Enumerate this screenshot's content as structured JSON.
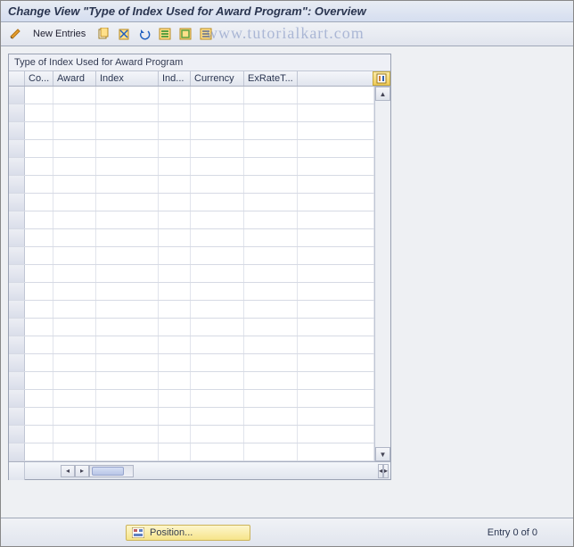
{
  "title": "Change View \"Type of Index Used for Award Program\": Overview",
  "toolbar": {
    "new_entries": "New Entries"
  },
  "watermark": "www.tutorialkart.com",
  "grid": {
    "title": "Type of Index Used for Award Program",
    "columns": [
      "Co...",
      "Award",
      "Index",
      "Ind...",
      "Currency",
      "ExRateT..."
    ],
    "row_count": 21
  },
  "footer": {
    "position_label": "Position...",
    "entry_status": "Entry 0 of 0"
  }
}
